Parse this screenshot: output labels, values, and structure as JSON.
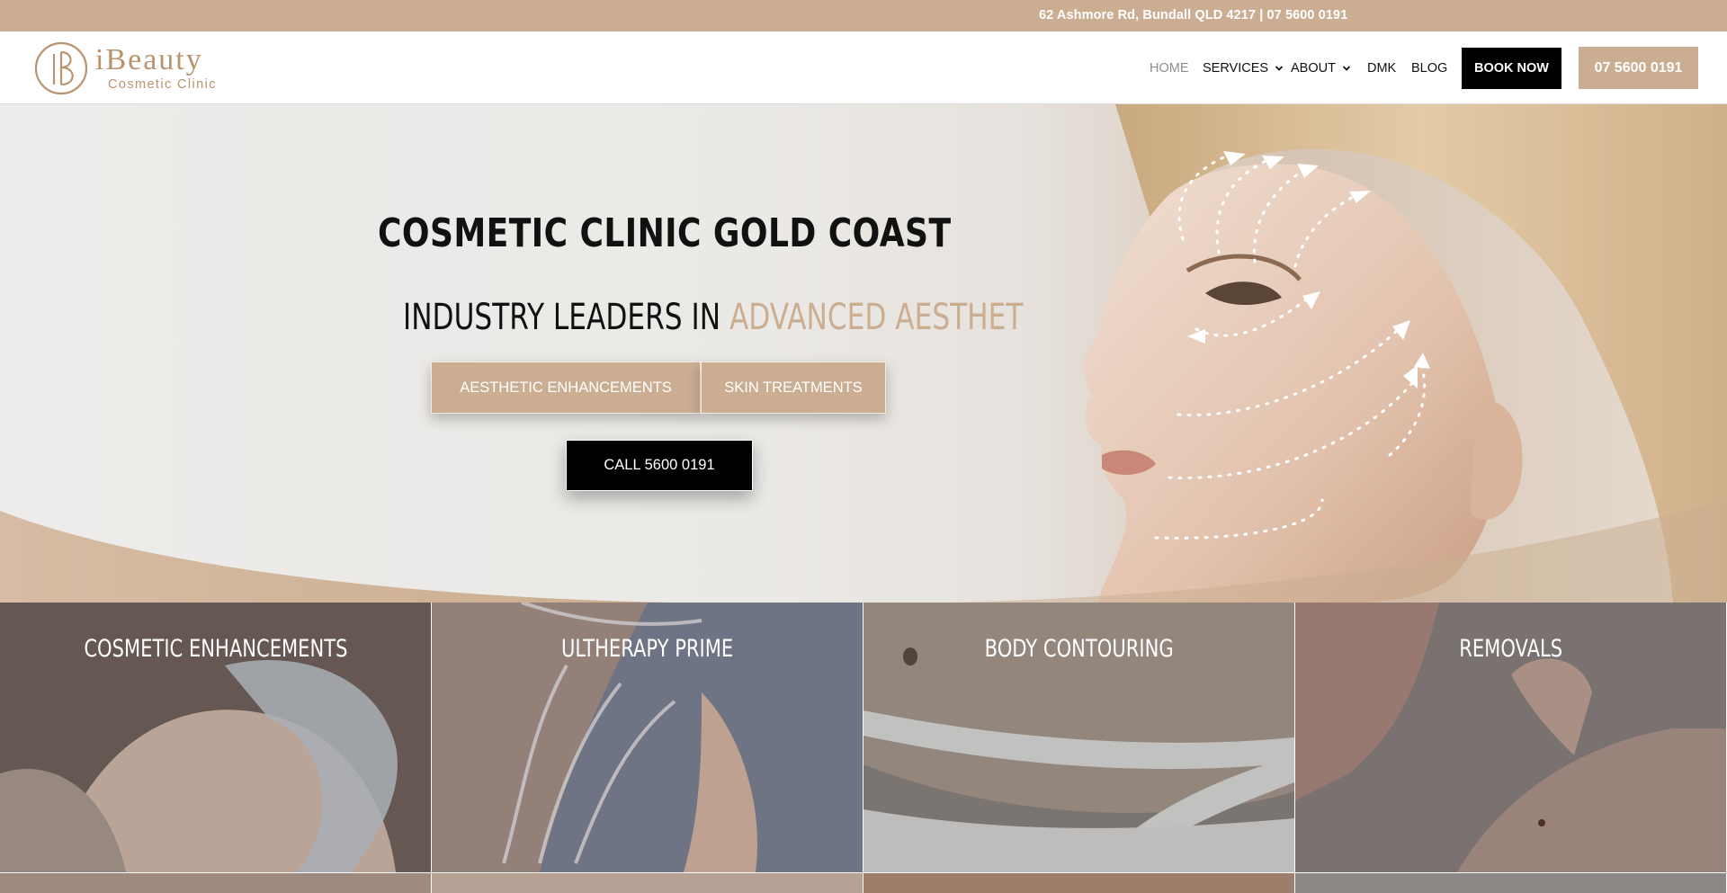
{
  "topbar": {
    "address": "62 Ashmore Rd, Bundall QLD 4217 | 07 5600 0191"
  },
  "logo": {
    "name": "iBeauty",
    "subtitle": "Cosmetic Clinic",
    "icon": "ib-monogram-icon"
  },
  "nav": {
    "items": [
      {
        "label": "HOME",
        "active": true,
        "dropdown": false
      },
      {
        "label": "SERVICES",
        "active": false,
        "dropdown": true
      },
      {
        "label": "ABOUT",
        "active": false,
        "dropdown": true
      },
      {
        "label": "DMK",
        "active": false,
        "dropdown": false
      },
      {
        "label": "BLOG",
        "active": false,
        "dropdown": false
      }
    ],
    "book_label": "BOOK NOW",
    "phone_label": "07 5600 0191"
  },
  "hero": {
    "title": "COSMETIC CLINIC GOLD COAST",
    "subtitle_prefix": "INDUSTRY LEADERS IN ",
    "subtitle_accent": "ADVANCED AESTHET",
    "btn_aesthetic": "AESTHETIC ENHANCEMENTS",
    "btn_skin": "SKIN TREATMENTS",
    "btn_call": "CALL 5600 0191"
  },
  "tiles": [
    {
      "title": "COSMETIC ENHANCEMENTS"
    },
    {
      "title": "ULTHERAPY PRIME"
    },
    {
      "title": "BODY CONTOURING"
    },
    {
      "title": "REMOVALS"
    }
  ],
  "colors": {
    "accent": "#cbae92",
    "black": "#000000",
    "nav_active": "#8d8d8d"
  }
}
